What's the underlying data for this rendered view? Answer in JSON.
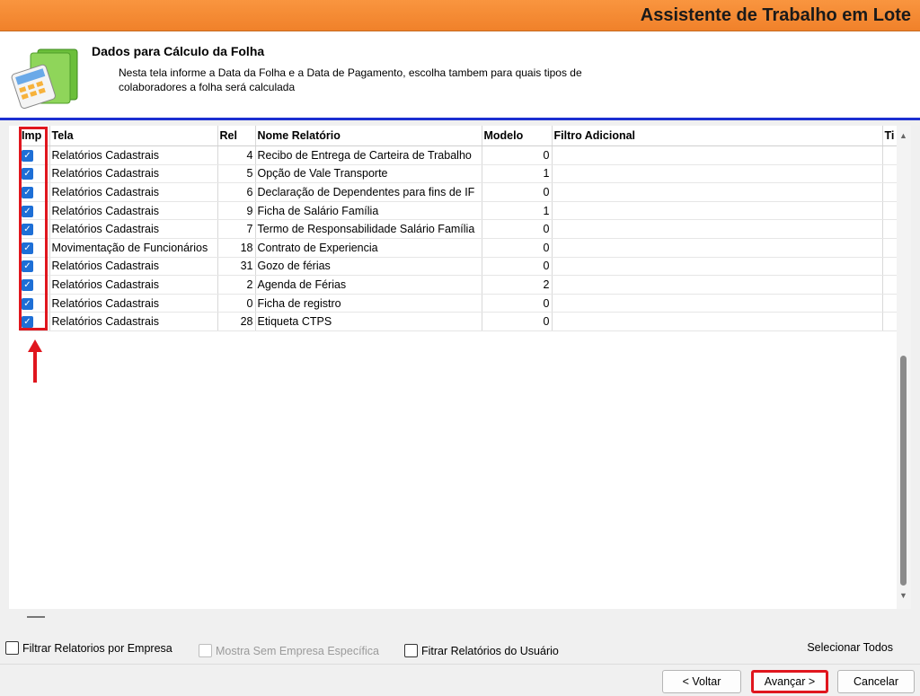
{
  "window": {
    "title": "Assistente de Trabalho em Lote"
  },
  "header": {
    "title": "Dados para Cálculo da Folha",
    "desc_line1": "Nesta tela informe a Data da Folha e a Data de Pagamento, escolha tambem para quais tipos de",
    "desc_line2": "colaboradores a folha será calculada"
  },
  "grid": {
    "columns": {
      "imp": "Imp",
      "tela": "Tela",
      "rel": "Rel",
      "nome": "Nome Relatório",
      "modelo": "Modelo",
      "filtro": "Filtro Adicional",
      "ti": "Ti"
    },
    "rows": [
      {
        "tela": "Relatórios Cadastrais",
        "rel": "4",
        "nome": "Recibo de Entrega de Carteira de Trabalho",
        "modelo": "0"
      },
      {
        "tela": "Relatórios Cadastrais",
        "rel": "5",
        "nome": "Opção de Vale Transporte",
        "modelo": "1"
      },
      {
        "tela": "Relatórios Cadastrais",
        "rel": "6",
        "nome": "Declaração de Dependentes para fins de IF",
        "modelo": "0"
      },
      {
        "tela": "Relatórios Cadastrais",
        "rel": "9",
        "nome": "Ficha de Salário Família",
        "modelo": "1"
      },
      {
        "tela": "Relatórios Cadastrais",
        "rel": "7",
        "nome": "Termo de Responsabilidade Salário Família",
        "modelo": "0"
      },
      {
        "tela": "Movimentação de Funcionários",
        "rel": "18",
        "nome": "Contrato de Experiencia",
        "modelo": "0"
      },
      {
        "tela": "Relatórios Cadastrais",
        "rel": "31",
        "nome": "Gozo de férias",
        "modelo": "0"
      },
      {
        "tela": "Relatórios Cadastrais",
        "rel": "2",
        "nome": "Agenda de Férias",
        "modelo": "2"
      },
      {
        "tela": "Relatórios Cadastrais",
        "rel": "0",
        "nome": "Ficha de registro",
        "modelo": "0"
      },
      {
        "tela": "Relatórios Cadastrais",
        "rel": "28",
        "nome": "Etiqueta CTPS",
        "modelo": "0"
      }
    ]
  },
  "filters": {
    "filtrar_empresa": "Filtrar Relatorios por Empresa",
    "mostra_sem_empresa": "Mostra Sem Empresa Específica",
    "filtrar_usuario": "Fitrar Relatórios do Usuário",
    "selecionar_todos": "Selecionar Todos"
  },
  "footer": {
    "voltar": "< Voltar",
    "avancar": "Avançar >",
    "cancelar": "Cancelar"
  },
  "colors": {
    "accent": "#f0812a",
    "highlight": "#e0161e",
    "checkbox": "#1e6fd6"
  }
}
